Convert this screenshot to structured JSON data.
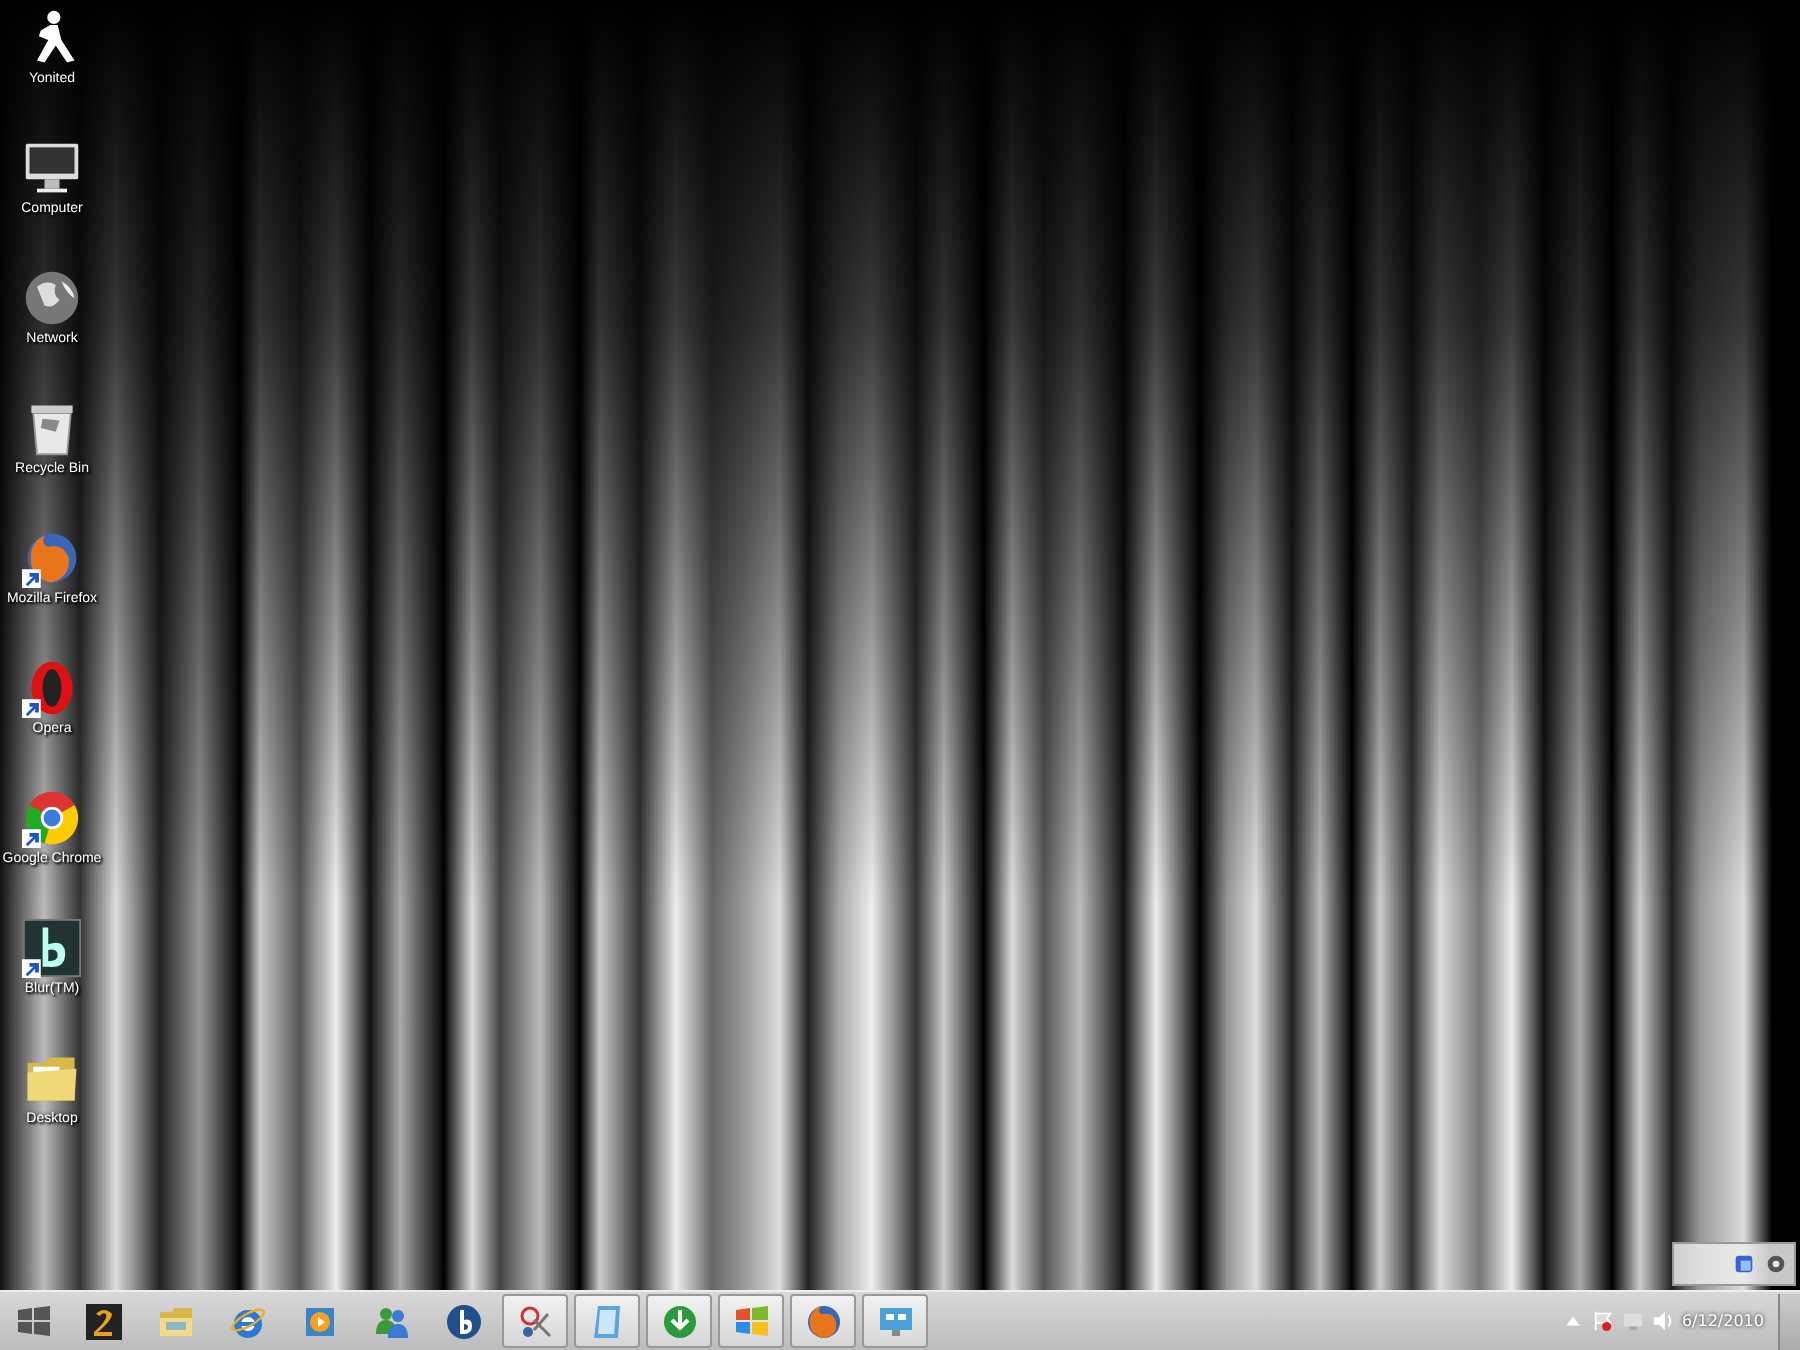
{
  "desktop_icons": [
    {
      "kind": "runner",
      "label": "Yonited",
      "shortcut": false
    },
    {
      "kind": "computer",
      "label": "Computer",
      "shortcut": false
    },
    {
      "kind": "globe",
      "label": "Network",
      "shortcut": false
    },
    {
      "kind": "bin",
      "label": "Recycle Bin",
      "shortcut": false
    },
    {
      "kind": "firefox",
      "label": "Mozilla Firefox",
      "shortcut": true
    },
    {
      "kind": "opera",
      "label": "Opera",
      "shortcut": true
    },
    {
      "kind": "chrome",
      "label": "Google Chrome",
      "shortcut": true
    },
    {
      "kind": "blur",
      "label": "Blur(TM)",
      "shortcut": true
    },
    {
      "kind": "folder",
      "label": "Desktop",
      "shortcut": false
    }
  ],
  "taskbar": {
    "items": [
      {
        "kind": "game",
        "running": false
      },
      {
        "kind": "folder",
        "running": false
      },
      {
        "kind": "ie",
        "running": false
      },
      {
        "kind": "media",
        "running": false
      },
      {
        "kind": "messenger",
        "running": false
      },
      {
        "kind": "bing",
        "running": false
      },
      {
        "kind": "scissors",
        "running": true
      },
      {
        "kind": "notepad",
        "running": true
      },
      {
        "kind": "download",
        "running": true
      },
      {
        "kind": "flag",
        "running": true
      },
      {
        "kind": "firefox",
        "running": true
      },
      {
        "kind": "monitor",
        "running": true
      }
    ],
    "date": "6/12/2010"
  }
}
